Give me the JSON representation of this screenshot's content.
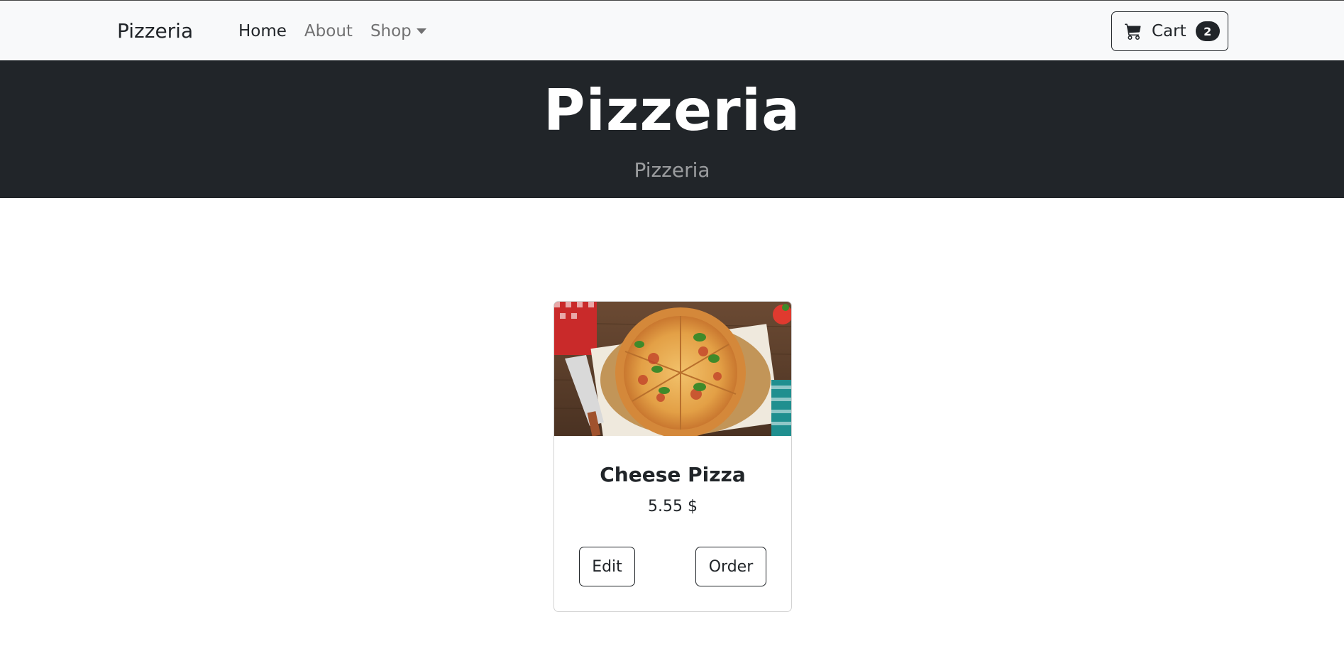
{
  "navbar": {
    "brand": "Pizzeria",
    "links": [
      {
        "label": "Home"
      },
      {
        "label": "About"
      },
      {
        "label": "Shop"
      }
    ],
    "cart": {
      "label": "Cart",
      "count": "2",
      "icon": "cart-icon"
    }
  },
  "hero": {
    "title": "Pizzeria",
    "subtitle": "Pizzeria"
  },
  "product": {
    "image": "pizza-photo",
    "name": "Cheese Pizza",
    "price": "5.55 $",
    "edit_label": "Edit",
    "order_label": "Order"
  },
  "colors": {
    "navbar_bg": "#f8f9fa",
    "hero_bg": "#212529",
    "text": "#212529"
  }
}
